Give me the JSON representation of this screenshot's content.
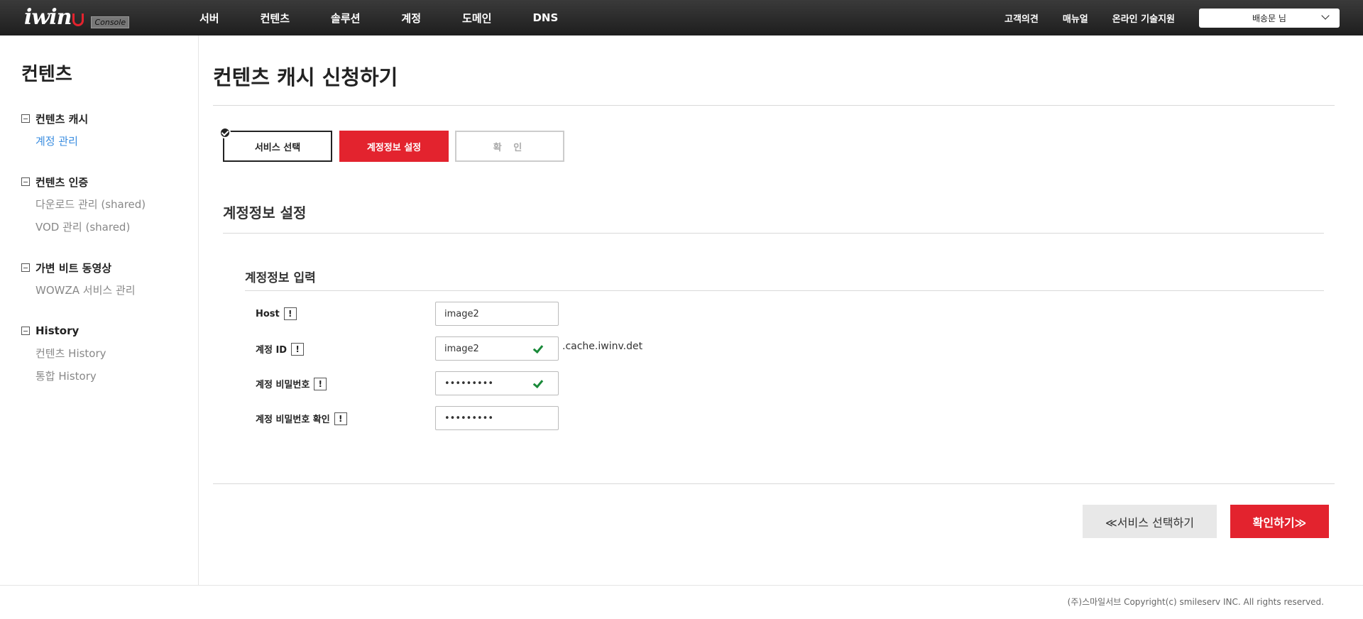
{
  "header": {
    "logo_text": "iwin",
    "logo_badge": "Console",
    "nav": [
      "서버",
      "컨텐츠",
      "솔루션",
      "계정",
      "도메인",
      "DNS"
    ],
    "util_links": [
      "고객의견",
      "매뉴얼",
      "온라인 기술지원"
    ],
    "user_label": "배송문 님"
  },
  "sidebar": {
    "title": "컨텐츠",
    "groups": [
      {
        "label": "컨텐츠 캐시",
        "items": [
          "계정 관리"
        ]
      },
      {
        "label": "컨텐츠 인증",
        "items": [
          "다운로드 관리 (shared)",
          "VOD 관리 (shared)"
        ]
      },
      {
        "label": "가변 비트 동영상",
        "items": [
          "WOWZA 서비스 관리"
        ]
      },
      {
        "label": "History",
        "items": [
          "컨텐츠 History",
          "통합 History"
        ]
      }
    ]
  },
  "main": {
    "page_title": "컨텐츠 캐시 신청하기",
    "steps": [
      "서비스 선택",
      "계정정보 설정",
      "확 인"
    ],
    "section_title": "계정정보 설정",
    "subsection_title": "계정정보 입력",
    "info_icon": "!",
    "fields": [
      {
        "label": "Host",
        "value": "image2"
      },
      {
        "label": "계정 ID",
        "value": "image2",
        "suffix": ".cache.iwinv.det"
      },
      {
        "label": "계정 비밀번호",
        "value": "•••••••••"
      },
      {
        "label": "계정 비밀번호 확인",
        "value": "•••••••••"
      }
    ],
    "prev_button": "≪서비스 선택하기",
    "confirm_button": "확인하기≫"
  },
  "footer": {
    "copyright": "(주)스마일서브 Copyright(c) smileserv INC. All rights reserved."
  },
  "colors": {
    "accent": "#e3232e",
    "active_link": "#3a8de0",
    "valid": "#1a8a3a",
    "topbar": "#2a2a2a"
  }
}
